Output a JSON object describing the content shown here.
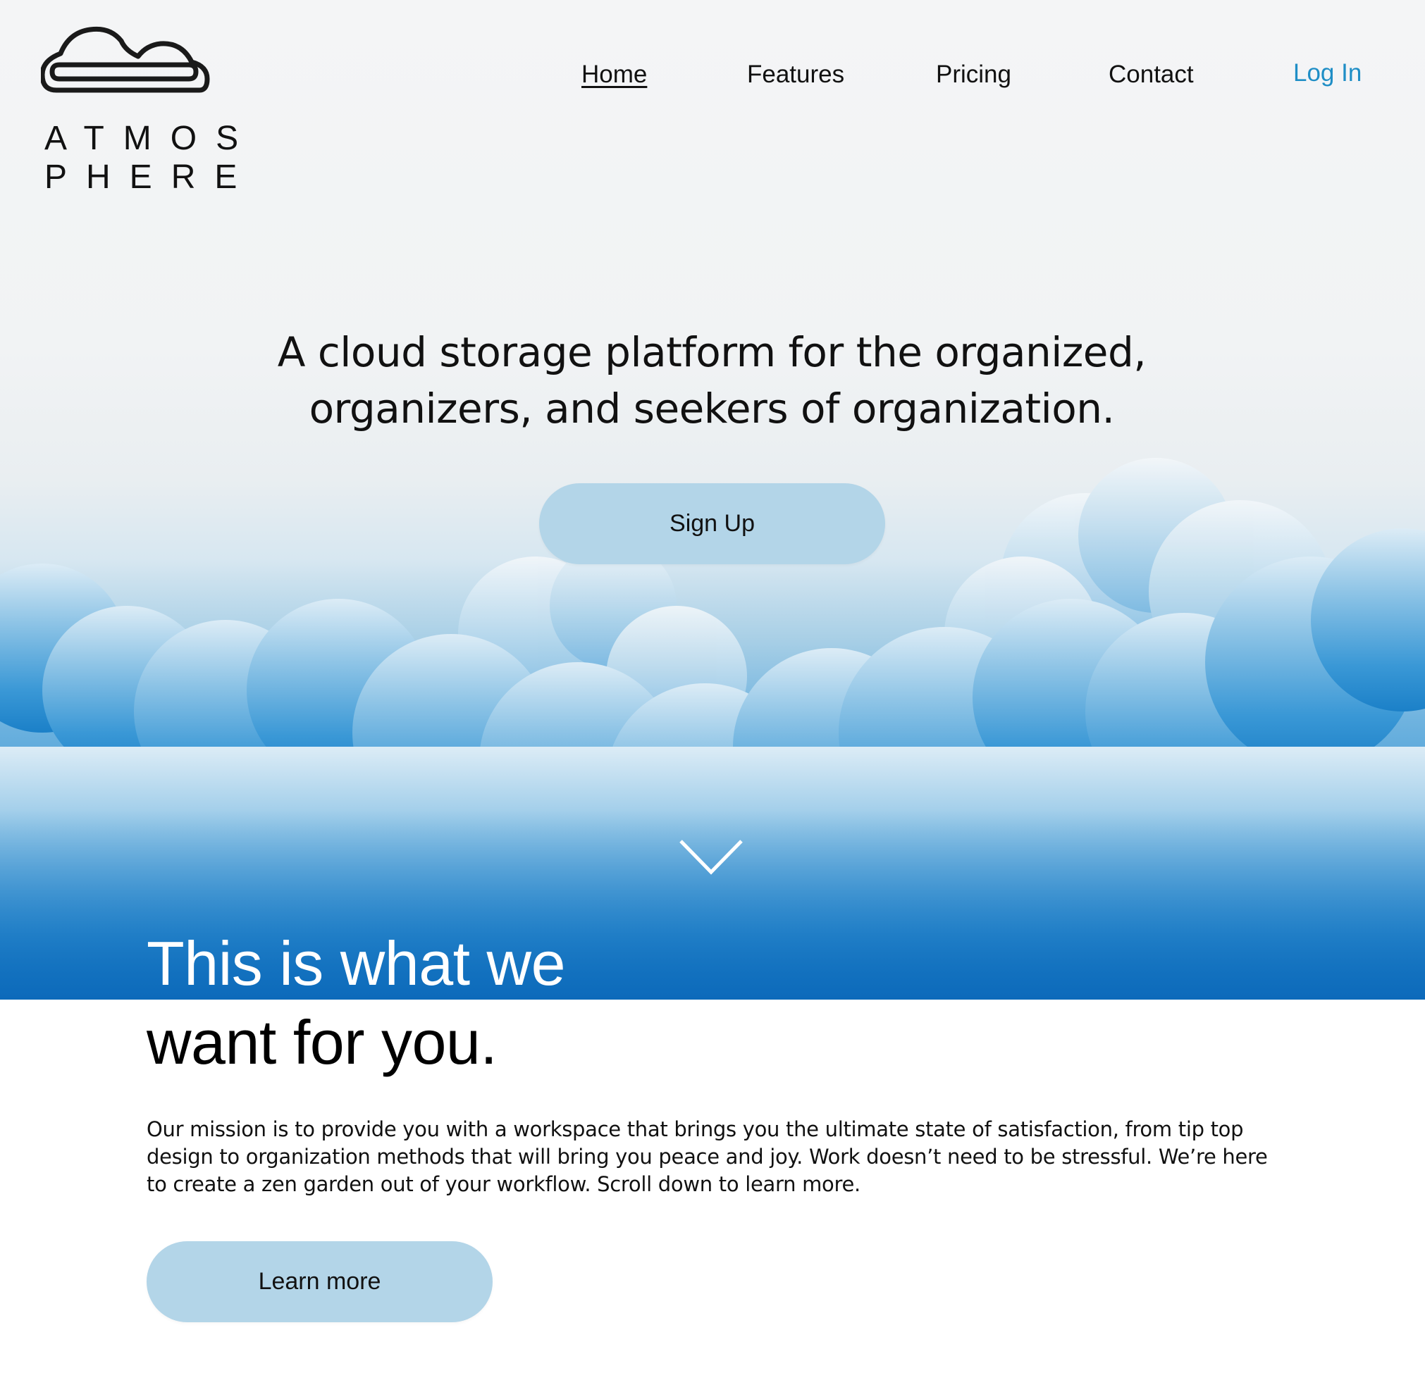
{
  "brand": {
    "logo_icon": "cloud-icon",
    "name_line1": "ATMOS",
    "name_line2": "PHERE"
  },
  "nav": {
    "items": [
      {
        "label": "Home",
        "active": true
      },
      {
        "label": "Features"
      },
      {
        "label": "Pricing"
      },
      {
        "label": "Contact"
      }
    ],
    "login_label": "Log In",
    "login_color": "#1f8ec6"
  },
  "hero": {
    "tagline_line1": "A cloud storage platform for the organized,",
    "tagline_line2": "organizers, and seekers of organization.",
    "signup_label": "Sign Up",
    "scroll_icon": "chevron-down-icon"
  },
  "about": {
    "headline_line1": "This is what we",
    "headline_line2": "want for you.",
    "mission_line1": "Our mission is to provide you with a workspace that brings you the ultimate state of satisfaction, from tip top",
    "mission_line2": "design to organization methods that will bring you peace and joy. Work doesn’t need to be stressful. We’re here",
    "mission_line3": "to create a zen garden out of your workflow. Scroll down to learn more.",
    "learn_more_label": "Learn more"
  },
  "colors": {
    "button_fill": "#b3d5e8",
    "sky_blue": "#1f86cc",
    "text": "#111111"
  }
}
